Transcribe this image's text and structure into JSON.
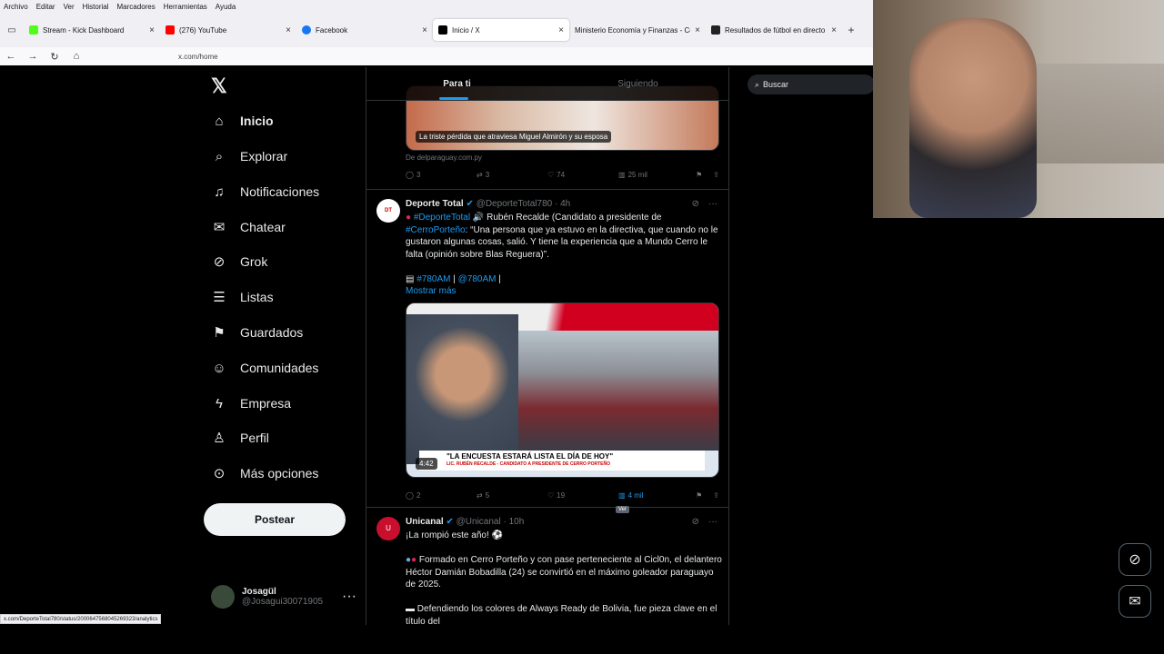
{
  "menu": [
    "Archivo",
    "Editar",
    "Ver",
    "Historial",
    "Marcadores",
    "Herramientas",
    "Ayuda"
  ],
  "tabs": [
    {
      "title": "Stream - Kick Dashboard",
      "color": "#53fc18"
    },
    {
      "title": "(276) YouTube",
      "color": "#ff0000"
    },
    {
      "title": "Facebook",
      "color": "#1877f2"
    },
    {
      "title": "Inicio / X",
      "color": "#000000"
    },
    {
      "title": "Ministerio Economía y Finanzas - Co",
      "color": "#dddddd"
    },
    {
      "title": "Resultados de fútbol en directo",
      "color": "#222222"
    }
  ],
  "url": "x.com/home",
  "nav": {
    "items": [
      "Inicio",
      "Explorar",
      "Notificaciones",
      "Chatear",
      "Grok",
      "Listas",
      "Guardados",
      "Comunidades",
      "Empresa",
      "Perfil",
      "Más opciones"
    ],
    "post_label": "Postear",
    "account_name": "Josagül",
    "account_handle": "@Josagui30071905"
  },
  "timeline": {
    "tab_for_you": "Para ti",
    "tab_following": "Siguiendo",
    "post1": {
      "caption": "La triste pérdida que atraviesa Miguel Almirón y su esposa",
      "source": "De delparaguay.com.py",
      "replies": "3",
      "reposts": "3",
      "likes": "74",
      "views": "25 mil"
    },
    "post2": {
      "name": "Deporte Total",
      "handle": "@DeporteTotal780 · 4h",
      "tag": "#DeporteTotal",
      "text1": "Rubén Recalde (Candidato a presidente de",
      "tag2": "#CerroPorteño",
      "text2": ": “Una persona que ya estuvo en la directiva, que cuando no le gustaron algunas cosas, salió. Y tiene la experiencia que a Mundo Cerro le falta (opinión sobre Blas Reguera)”.",
      "tag3": "#780AM",
      "tag4": "@780AM",
      "more": "Mostrar más",
      "banner": "\"LA ENCUESTA ESTARÁ LISTA EL DÍA DE HOY\"",
      "banner_sub": "LIC. RUBÉN RECALDE - CANDIDATO A PRESIDENTE DE CERRO PORTEÑO",
      "duration": "4:42",
      "replies": "2",
      "reposts": "5",
      "likes": "19",
      "views": "4 mil",
      "tooltip": "Ver"
    },
    "post3": {
      "name": "Unicanal",
      "handle": "@Unicanal · 10h",
      "line1": "¡La rompió este año!",
      "para1": "Formado en Cerro Porteño y con pase perteneciente al Cicl0n, el delantero Héctor Damián Bobadilla (24) se convirtió en el máximo goleador paraguayo de 2025.",
      "para2": "Defendiendo los colores de Always Ready de Bolivia, fue pieza clave en el título del"
    }
  },
  "search_placeholder": "Buscar",
  "status_url": "x.com/DeporteTotal780/status/2000647568045269323/analytics"
}
